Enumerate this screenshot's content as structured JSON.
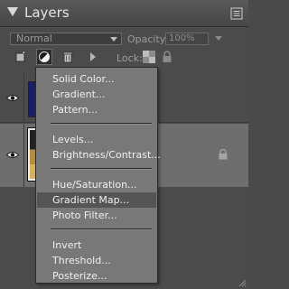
{
  "panel": {
    "title": "Layers",
    "blend_mode": "Normal",
    "opacity_label": "Opacity:",
    "opacity_value": "100%",
    "lock_label": "Lock:"
  },
  "adjustment_menu": {
    "items": [
      {
        "label": "Solid Color..."
      },
      {
        "label": "Gradient..."
      },
      {
        "label": "Pattern..."
      },
      {
        "label": "Levels..."
      },
      {
        "label": "Brightness/Contrast..."
      },
      {
        "label": "Hue/Saturation..."
      },
      {
        "label": "Gradient Map...",
        "highlighted": true
      },
      {
        "label": "Photo Filter..."
      },
      {
        "label": "Invert"
      },
      {
        "label": "Threshold..."
      },
      {
        "label": "Posterize..."
      }
    ]
  },
  "colors": {
    "panel_bg": "#4b4b4b",
    "menu_bg": "#787878",
    "menu_highlight": "#555555",
    "selected_layer": "#6e6e6e"
  }
}
